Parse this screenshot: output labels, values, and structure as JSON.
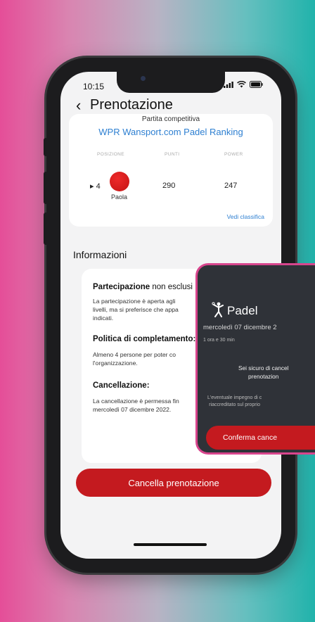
{
  "status_bar": {
    "time": "10:15"
  },
  "header": {
    "title": "Prenotazione"
  },
  "ranking": {
    "match_type": "Partita competitiva",
    "title": "WPR Wansport.com Padel Ranking",
    "headers": [
      "POSIZIONE",
      "PUNTI",
      "POWER"
    ],
    "position": "▸ 4",
    "player": "Paola",
    "points": "290",
    "power": "247",
    "link": "Vedi classifica"
  },
  "info": {
    "section_title": "Informazioni",
    "items": [
      {
        "title": "Partecipazione",
        "title_rest": " non esclusi",
        "lines": [
          "La partecipazione è aperta agli",
          "livelli, ma si preferisce che appa",
          "indicati."
        ]
      },
      {
        "title": "Politica di completamento:",
        "title_rest": "",
        "lines": [
          "Almeno 4 persone per poter co",
          "l'organizzazione."
        ]
      },
      {
        "title": "Cancellazione:",
        "title_rest": "",
        "lines": [
          "La cancellazione è permessa fin",
          "mercoledì 07 dicembre 2022."
        ]
      }
    ]
  },
  "buttons": {
    "cancel_booking": "Cancella prenotazione"
  },
  "popup": {
    "sport": "Padel",
    "date": "mercoledì 07 dicembre 2",
    "duration": "1 ora e 30 min",
    "question_line1": "Sei sicuro di cancel",
    "question_line2": "prenotazion",
    "note_line1": "L'eventuale impegno di c",
    "note_line2": "riaccreditato sul proprio",
    "confirm": "Conferma cance"
  },
  "colors": {
    "accent_red": "#c41a1f",
    "link_blue": "#2d7fd1",
    "popup_border": "#d8458d",
    "popup_bg": "#2f3238"
  }
}
